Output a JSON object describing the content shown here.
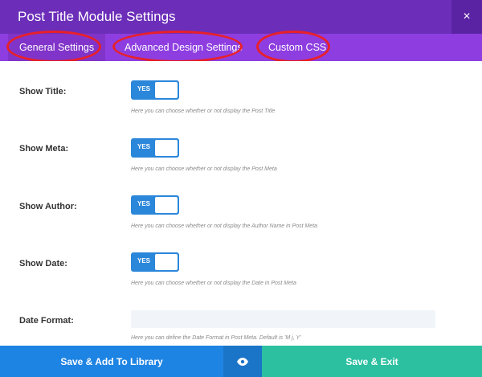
{
  "window": {
    "title": "Post Title Module Settings",
    "close_symbol": "×"
  },
  "tabs": [
    {
      "label": "General Settings",
      "active": true
    },
    {
      "label": "Advanced Design Settings",
      "active": false
    },
    {
      "label": "Custom CSS",
      "active": false
    }
  ],
  "settings": [
    {
      "label": "Show Title:",
      "toggle_text": "YES",
      "help": "Here you can choose whether or not display the Post Title"
    },
    {
      "label": "Show Meta:",
      "toggle_text": "YES",
      "help": "Here you can choose whether or not display the Post Meta"
    },
    {
      "label": "Show Author:",
      "toggle_text": "YES",
      "help": "Here you can choose whether or not display the Author Name in Post Meta"
    },
    {
      "label": "Show Date:",
      "toggle_text": "YES",
      "help": "Here you can choose whether or not display the Date in Post Meta"
    }
  ],
  "date_format": {
    "label": "Date Format:",
    "value": "",
    "help": "Here you can define the Date Format in Post Meta. Default is 'M j, Y'"
  },
  "footer": {
    "save_library_label": "Save & Add To Library",
    "preview_icon": "eye-icon",
    "save_exit_label": "Save & Exit"
  },
  "colors": {
    "header": "#6c2eb9",
    "tabs": "#8e3ee0",
    "toggle_on": "#2b87da",
    "highlight_ring": "#e8202a",
    "save_library": "#1e84e3",
    "save_exit": "#2cc0a0"
  }
}
